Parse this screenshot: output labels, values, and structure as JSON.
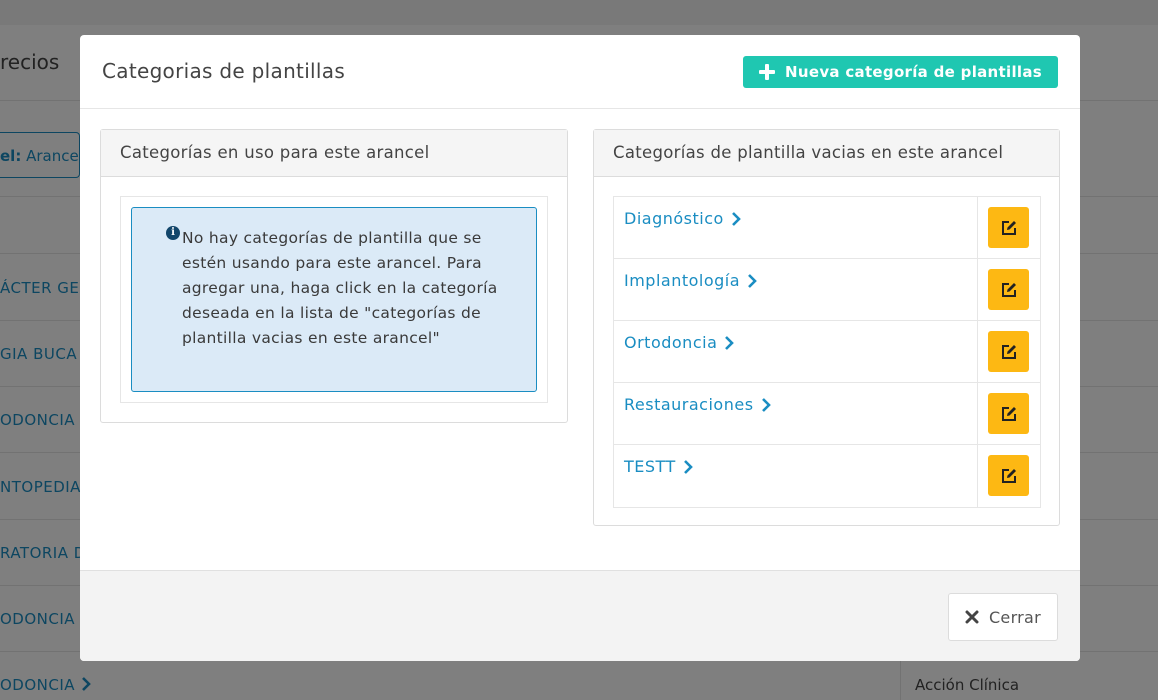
{
  "background": {
    "title": "recios",
    "tab_label_bold": "el:",
    "tab_label": "Arance",
    "rows": [
      "ÁCTER GE",
      "GIA BUCA",
      "ODONCIA",
      "NTOPEDIA",
      "RATORIA D",
      "ODONCIA",
      "ODONCIA"
    ],
    "right_column_text": "Acción Clínica"
  },
  "modal": {
    "title": "Categorias de plantillas",
    "new_button_label": "Nueva categoría de plantillas",
    "left_panel": {
      "title": "Categorías en uso para este arancel",
      "alert_text": "No hay categorías de plantilla que se estén usando para este arancel. Para agregar una, haga click en la categoría deseada en la lista de \"categorías de plantilla vacias en este arancel\""
    },
    "right_panel": {
      "title": "Categorías de plantilla vacias en este arancel",
      "categories": [
        "Diagnóstico",
        "Implantología",
        "Ortodoncia",
        "Restauraciones",
        "TESTT"
      ]
    },
    "close_button_label": "Cerrar"
  },
  "colors": {
    "accent_teal": "#1fc7b1",
    "link_blue": "#1a8dc2",
    "edit_yellow": "#fdb813",
    "alert_bg": "#dbeaf7"
  },
  "icons": [
    "plus-icon",
    "info-icon",
    "chevron-right-icon",
    "edit-icon",
    "close-icon"
  ]
}
